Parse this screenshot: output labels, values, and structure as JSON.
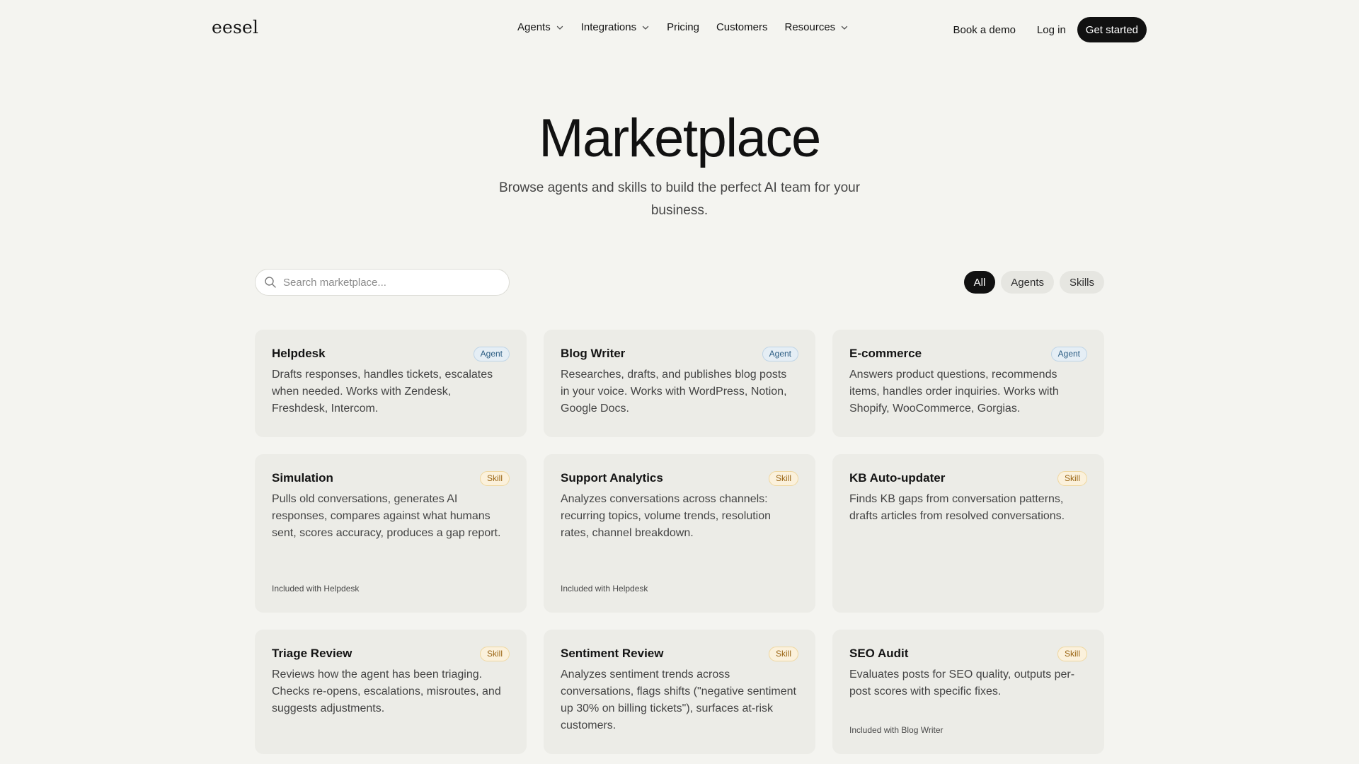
{
  "header": {
    "logo": "eesel",
    "nav": [
      {
        "label": "Agents",
        "has_dropdown": true
      },
      {
        "label": "Integrations",
        "has_dropdown": true
      },
      {
        "label": "Pricing",
        "has_dropdown": false
      },
      {
        "label": "Customers",
        "has_dropdown": false
      },
      {
        "label": "Resources",
        "has_dropdown": true
      }
    ],
    "book_demo": "Book a demo",
    "log_in": "Log in",
    "get_started": "Get started"
  },
  "hero": {
    "title": "Marketplace",
    "subtitle": "Browse agents and skills to build the perfect AI team for your business."
  },
  "search": {
    "placeholder": "Search marketplace...",
    "value": ""
  },
  "filters": {
    "all": "All",
    "agents": "Agents",
    "skills": "Skills",
    "active": "All"
  },
  "cards": [
    {
      "title": "Helpdesk",
      "badge": "Agent",
      "description": "Drafts responses, handles tickets, escalates when needed. Works with Zendesk, Freshdesk, Intercom.",
      "footer": ""
    },
    {
      "title": "Blog Writer",
      "badge": "Agent",
      "description": "Researches, drafts, and publishes blog posts in your voice. Works with WordPress, Notion, Google Docs.",
      "footer": ""
    },
    {
      "title": "E-commerce",
      "badge": "Agent",
      "description": "Answers product questions, recommends items, handles order inquiries. Works with Shopify, WooCommerce, Gorgias.",
      "footer": ""
    },
    {
      "title": "Simulation",
      "badge": "Skill",
      "description": "Pulls old conversations, generates AI responses, compares against what humans sent, scores accuracy, produces a gap report.",
      "footer": "Included with Helpdesk"
    },
    {
      "title": "Support Analytics",
      "badge": "Skill",
      "description": "Analyzes conversations across channels: recurring topics, volume trends, resolution rates, channel breakdown.",
      "footer": "Included with Helpdesk"
    },
    {
      "title": "KB Auto-updater",
      "badge": "Skill",
      "description": "Finds KB gaps from conversation patterns, drafts articles from resolved conversations.",
      "footer": ""
    },
    {
      "title": "Triage Review",
      "badge": "Skill",
      "description": "Reviews how the agent has been triaging. Checks re-opens, escalations, misroutes, and suggests adjustments.",
      "footer": ""
    },
    {
      "title": "Sentiment Review",
      "badge": "Skill",
      "description": "Analyzes sentiment trends across conversations, flags shifts (\"negative sentiment up 30% on billing tickets\"), surfaces at-risk customers.",
      "footer": ""
    },
    {
      "title": "SEO Audit",
      "badge": "Skill",
      "description": "Evaluates posts for SEO quality, outputs per-post scores with specific fixes.",
      "footer": "Included with Blog Writer"
    }
  ],
  "colors": {
    "background": "#f4f4f0",
    "card": "#ecece7",
    "primary_button": "#111111",
    "agent_badge": "#2c5d83",
    "skill_badge": "#9a6514"
  },
  "icons": {
    "search": "search-icon",
    "dropdown": "chevron-down-icon"
  }
}
